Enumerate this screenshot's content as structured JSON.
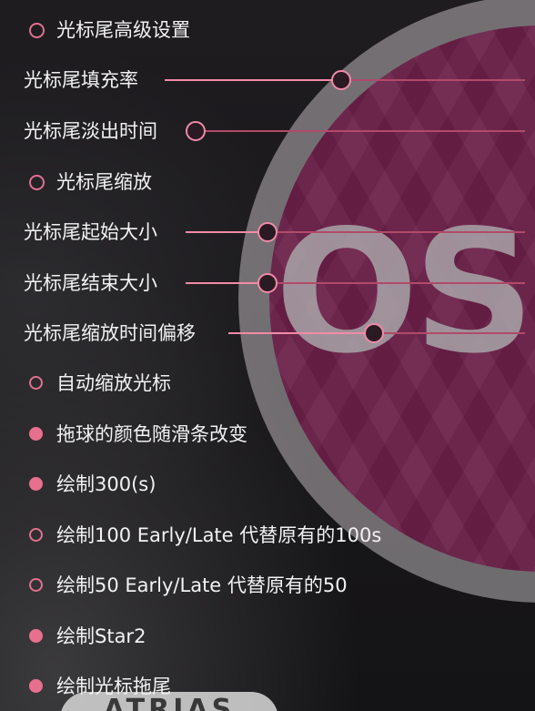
{
  "settings": {
    "cursor_trail_advanced": {
      "label": "光标尾高级设置",
      "checked": false
    },
    "cursor_trail_fill": {
      "label": "光标尾填充率",
      "value_fraction": 0.49
    },
    "cursor_trail_fade_time": {
      "label": "光标尾淡出时间",
      "value_fraction": 0.03
    },
    "cursor_trail_scale": {
      "label": "光标尾缩放",
      "checked": false
    },
    "cursor_trail_start_size": {
      "label": "光标尾起始大小",
      "value_fraction": 0.24
    },
    "cursor_trail_end_size": {
      "label": "光标尾结束大小",
      "value_fraction": 0.24
    },
    "cursor_trail_scale_time_offset": {
      "label": "光标尾缩放时间偏移",
      "value_fraction": 0.49
    },
    "auto_scale_cursor": {
      "label": "自动缩放光标",
      "checked": false
    },
    "slider_ball_color": {
      "label": "拖球的颜色随滑条改变",
      "checked": true
    },
    "draw_300s": {
      "label": "绘制300(s)",
      "checked": true
    },
    "draw_100_early_late": {
      "label": "绘制100 Early/Late 代替原有的100s",
      "checked": false
    },
    "draw_50_early_late": {
      "label": "绘制50 Early/Late 代替原有的50",
      "checked": false
    },
    "draw_star2": {
      "label": "绘制Star2",
      "checked": true
    },
    "draw_cursor_trail": {
      "label": "绘制光标拖尾",
      "checked": true
    }
  },
  "background": {
    "logo_text": "OS",
    "banner_text": "ATRIAS",
    "disc_color": "#6a1f47",
    "accent_color": "#e8708f"
  }
}
